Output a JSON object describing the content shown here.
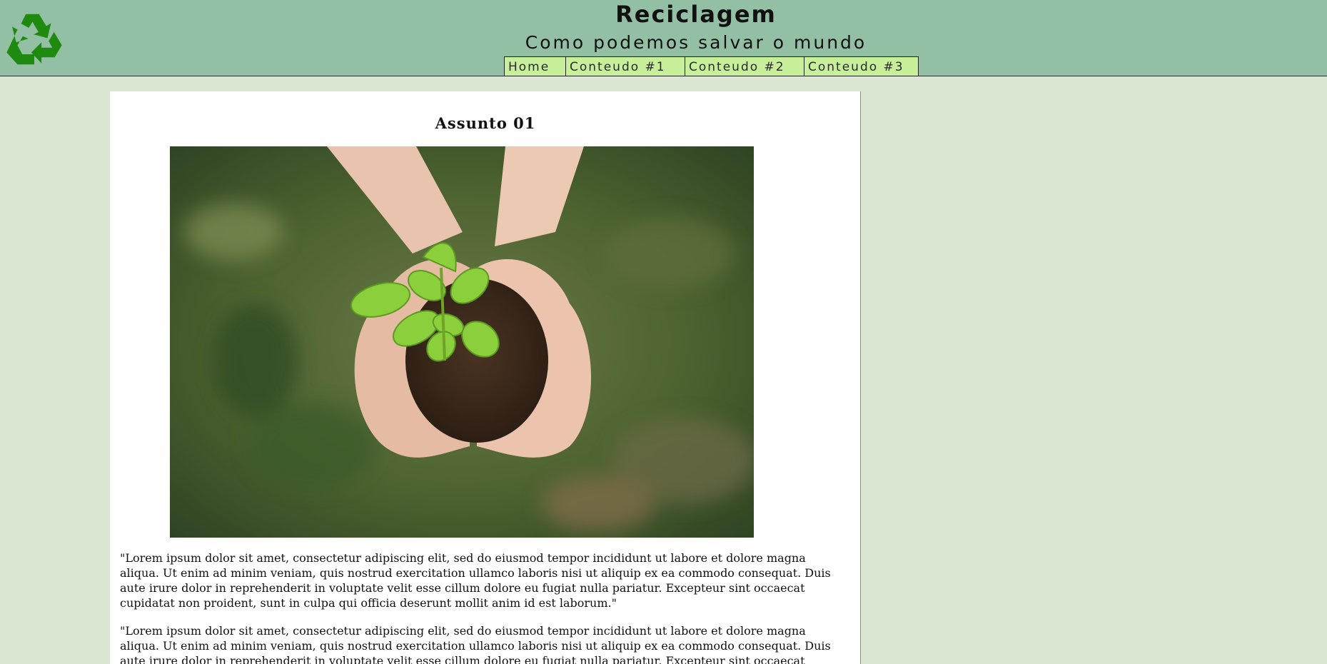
{
  "header": {
    "title": "Reciclagem",
    "subtitle": "Como podemos salvar o mundo",
    "logo_icon": "recycle-icon",
    "background_color": "#93c0a4",
    "logo_color": "#1e8a10"
  },
  "nav": {
    "items": [
      {
        "label": "Home"
      },
      {
        "label": "Conteudo #1"
      },
      {
        "label": "Conteudo #2"
      },
      {
        "label": "Conteudo #3"
      }
    ],
    "item_color": "#c8f09a"
  },
  "main": {
    "heading": "Assunto 01",
    "image_subject": "hands-holding-seedling-photo",
    "paragraphs": [
      "\"Lorem ipsum dolor sit amet, consectetur adipiscing elit, sed do eiusmod tempor incididunt ut labore et dolore magna aliqua. Ut enim ad minim veniam, quis nostrud exercitation ullamco laboris nisi ut aliquip ex ea commodo consequat. Duis aute irure dolor in reprehenderit in voluptate velit esse cillum dolore eu fugiat nulla pariatur. Excepteur sint occaecat cupidatat non proident, sunt in culpa qui officia deserunt mollit anim id est laborum.\"",
      "\"Lorem ipsum dolor sit amet, consectetur adipiscing elit, sed do eiusmod tempor incididunt ut labore et dolore magna aliqua. Ut enim ad minim veniam, quis nostrud exercitation ullamco laboris nisi ut aliquip ex ea commodo consequat. Duis aute irure dolor in reprehenderit in voluptate velit esse cillum dolore eu fugiat nulla pariatur. Excepteur sint occaecat cupidatat non proident, sunt in culpa qui officia deserunt mollit anim id est laborum.\""
    ]
  },
  "page_background": "#dae5d2"
}
